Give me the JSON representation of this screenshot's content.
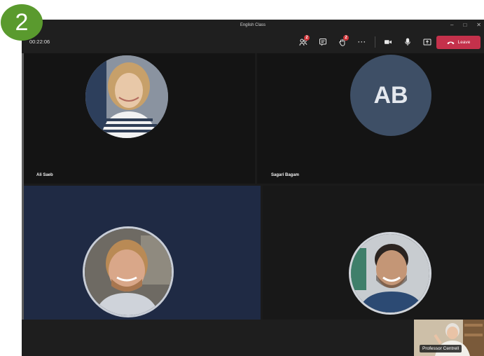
{
  "step_badge": "2",
  "window": {
    "title": "English Class"
  },
  "window_controls": {
    "minimize": "–",
    "maximize": "□",
    "close": "✕"
  },
  "toolbar": {
    "timer": "00:22:06",
    "participants_count": "2",
    "raised_hands_count": "2",
    "more_label": "···",
    "leave_label": "Leave"
  },
  "participants": [
    {
      "name": "Ali Saeb",
      "type": "video",
      "hair": "#c7a06a",
      "skin": "#e8c8a8",
      "shirt": "stripes"
    },
    {
      "name": "Sagari Bagam",
      "type": "initials",
      "initials": "AB",
      "circle_color": "#3e4f66"
    },
    {
      "name": "",
      "type": "video",
      "hair": "#b98a55",
      "skin": "#d9a789",
      "shirt": "#cfd3da"
    },
    {
      "name": "",
      "type": "video",
      "hair": "#2b2420",
      "skin": "#c49676",
      "shirt": "#2c4a73"
    }
  ],
  "self_view": {
    "name": "Professor Centrell"
  },
  "colors": {
    "leave": "#c4314b",
    "badge": "#d13438",
    "step": "#5a9a2e"
  },
  "icons": [
    "participants-icon",
    "chat-icon",
    "raise-hand-icon",
    "more-icon",
    "camera-icon",
    "mic-icon",
    "share-icon",
    "phone-icon"
  ]
}
